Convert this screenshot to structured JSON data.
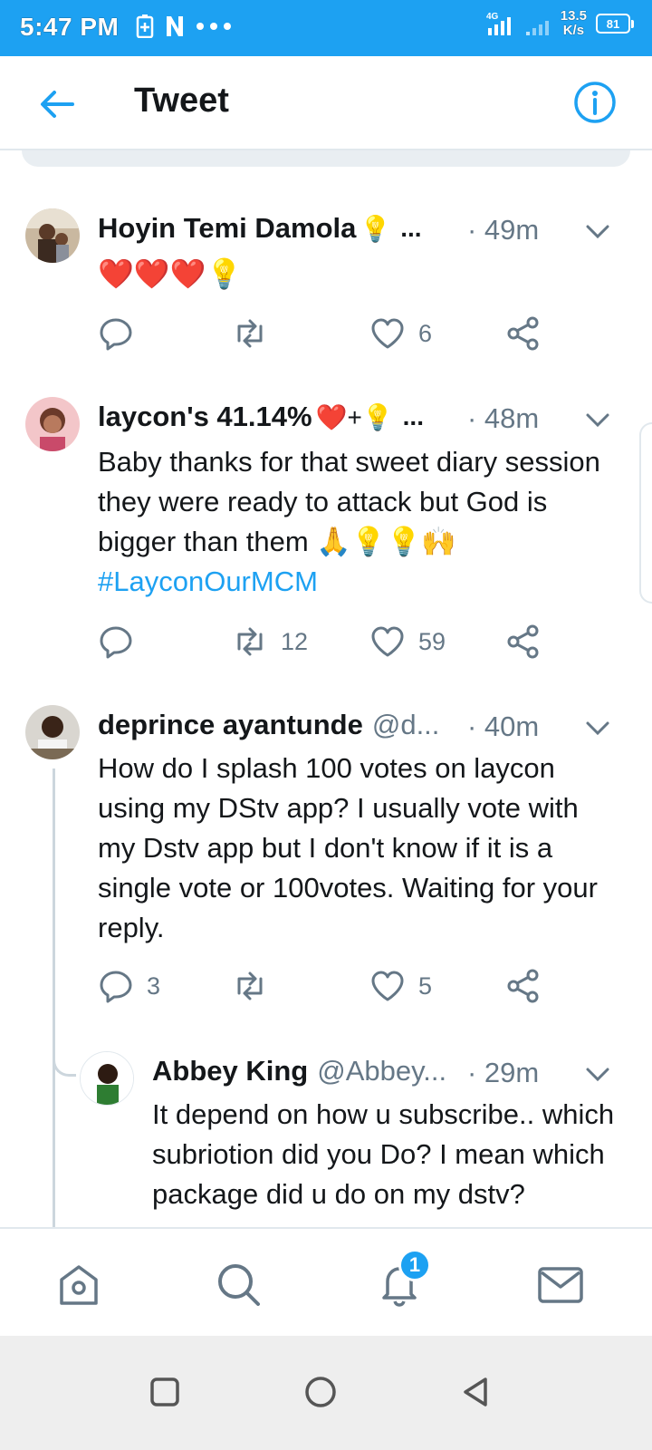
{
  "status_bar": {
    "time": "5:47 PM",
    "network_type": "4G",
    "net_speed_value": "13.5",
    "net_speed_unit": "K/s",
    "battery": "81"
  },
  "header": {
    "title": "Tweet"
  },
  "tweets": [
    {
      "name": "Hoyin Temi Damola",
      "name_emoji": "💡",
      "truncation": "...",
      "time": "· 49m",
      "body_emoji": "❤️❤️❤️💡",
      "replies": "",
      "retweets": "",
      "likes": "6"
    },
    {
      "name": "laycon's 41.14%",
      "name_emoji": "❤️+💡",
      "truncation": "...",
      "time": "· 48m",
      "body": "Baby thanks for that sweet diary session they were ready to attack but God is bigger than them 🙏💡💡🙌",
      "hashtag": "#LayconOurMCM",
      "replies": "",
      "retweets": "12",
      "likes": "59"
    },
    {
      "name": "deprince ayantunde",
      "handle": "@d...",
      "time": "· 40m",
      "body": "How do I splash 100 votes on laycon using my DStv app? I usually vote with my Dstv app but I don't know if it is a single vote or 100votes. Waiting for your reply.",
      "replies": "3",
      "retweets": "",
      "likes": "5"
    },
    {
      "name": "Abbey King",
      "handle": "@Abbey...",
      "time": "· 29m",
      "body": "It depend on how u subscribe.. which subriotion did you Do? I mean which package did u do on my dstv?"
    }
  ],
  "bottom_nav": {
    "items": [
      "home",
      "search",
      "notifications",
      "messages"
    ],
    "notification_count": "1"
  },
  "colors": {
    "accent": "#1da1f2",
    "text": "#14171a",
    "muted": "#657786",
    "heart": "#cc1a3a"
  }
}
